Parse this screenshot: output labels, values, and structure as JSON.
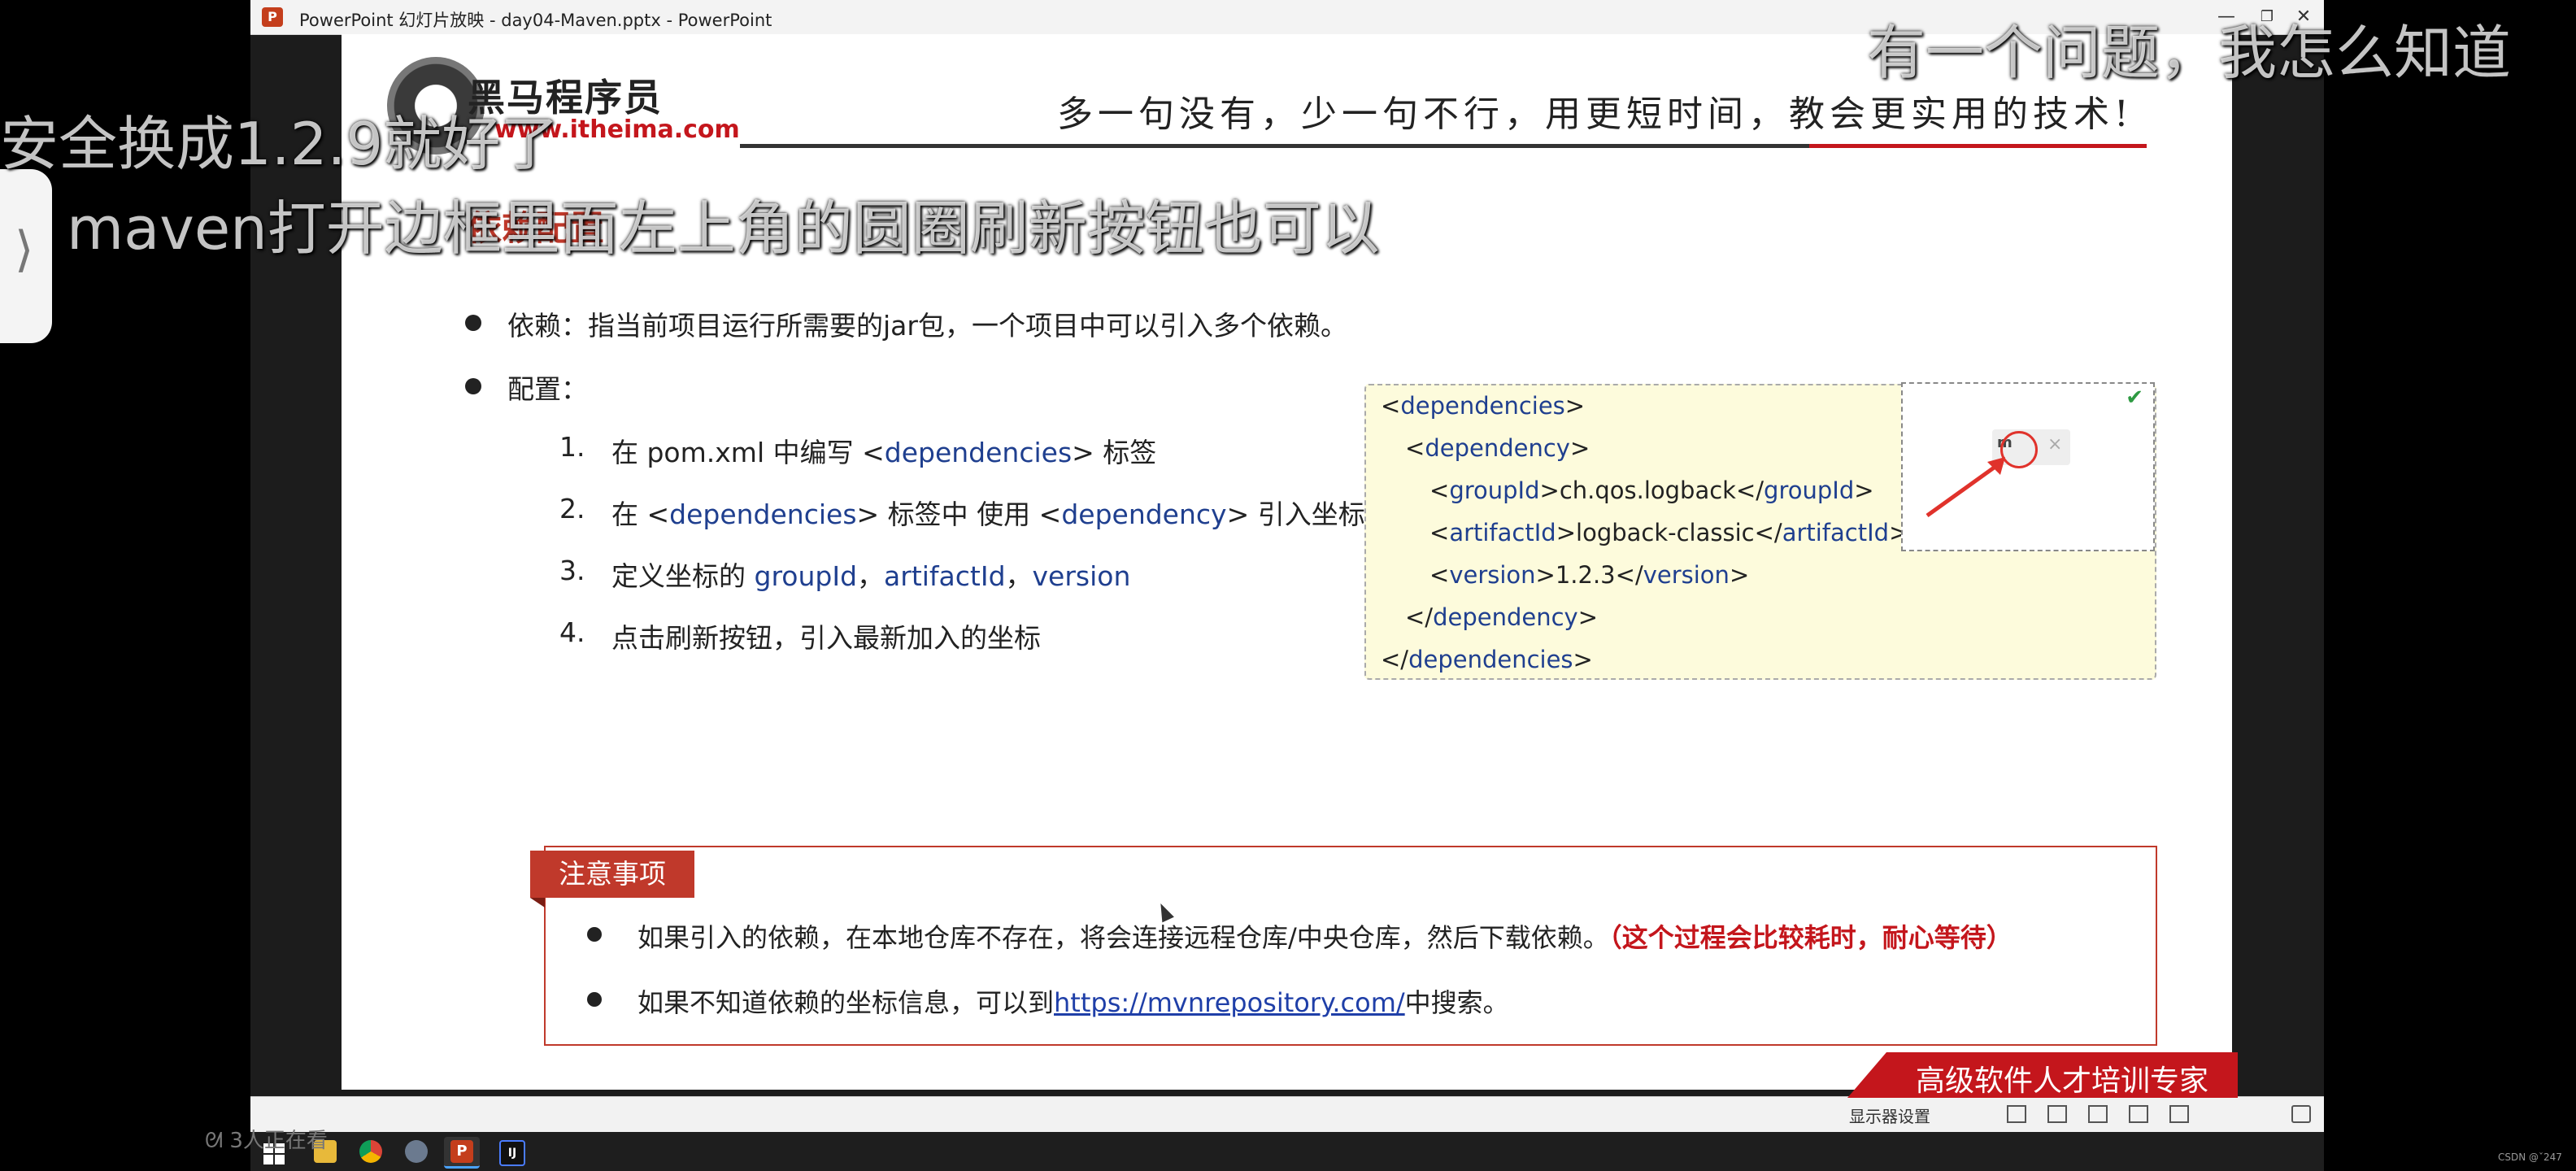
{
  "window": {
    "title": "PowerPoint 幻灯片放映  -  day04-Maven.pptx - PowerPoint",
    "minimize": "—",
    "restore": "❐",
    "close": "✕"
  },
  "slide": {
    "logo_cn": "黑马程序员",
    "logo_url": "www.itheima.com",
    "slogan": "多一句没有，少一句不行，用更短时间，教会更实用的技术!",
    "section_title": "依赖配置",
    "bullets": [
      "依赖：指当前项目运行所需要的jar包，一个项目中可以引入多个依赖。",
      "配置："
    ],
    "steps": [
      {
        "num": "1.",
        "pre": "在 pom.xml 中编写 <",
        "blue": "dependencies",
        "post": "> 标签"
      },
      {
        "num": "2.",
        "pre": "在 <",
        "blue": "dependencies",
        "mid": "> 标签中 使用 <",
        "blue2": "dependency",
        "post": "> 引入坐标"
      },
      {
        "num": "3.",
        "pre": "定义坐标的 ",
        "blue": "groupId",
        "sep1": "，",
        "blue2": "artifactId",
        "sep2": "，",
        "blue3": "version"
      },
      {
        "num": "4.",
        "pre": "点击刷新按钮，引入最新加入的坐标"
      }
    ],
    "code": {
      "deps": "dependencies",
      "dep": "dependency",
      "groupId_tag": "groupId",
      "groupId_val": "ch.qos.logback",
      "artifactId_tag": "artifactId",
      "artifactId_val": "logback-classic",
      "version_tag": "version",
      "version_val": "1.2.3"
    },
    "inset": {
      "check": "✔",
      "chip_label": "m",
      "chip_close": "×"
    },
    "notice": {
      "tag": "注意事项",
      "line1_text": "如果引入的依赖，在本地仓库不存在，将会连接远程仓库/中央仓库，然后下载依赖。",
      "line1_note": "（这个过程会比较耗时，耐心等待）",
      "line2_pre": "如果不知道依赖的坐标信息，可以到",
      "line2_link": "https://mvnrepository.com/",
      "line2_post": "中搜索。"
    },
    "footer": "高级软件人才培训专家"
  },
  "statusbar": {
    "display_settings": "显示器设置"
  },
  "taskbar": {
    "apps": [
      "windows-start",
      "file-explorer",
      "chrome",
      "settings",
      "powerpoint",
      "intellij-idea"
    ],
    "ppt_label": "P",
    "idea_label": "IJ"
  },
  "overlays": {
    "danmaku_top": "有一个问题，我怎么知道",
    "danmaku_left": "安全换成1.2.9就好了",
    "danmaku_mid": "maven打开边框里面左上角的圆圈刷新按钮也可以",
    "side_arrow": "⟩",
    "corner_user": "ᘛ 3人正在看",
    "csdn": "CSDN @ˇ247"
  },
  "colors": {
    "brand_red": "#c4161c",
    "tag_blue": "#1f3f8f",
    "code_bg": "#fdfbdc"
  }
}
